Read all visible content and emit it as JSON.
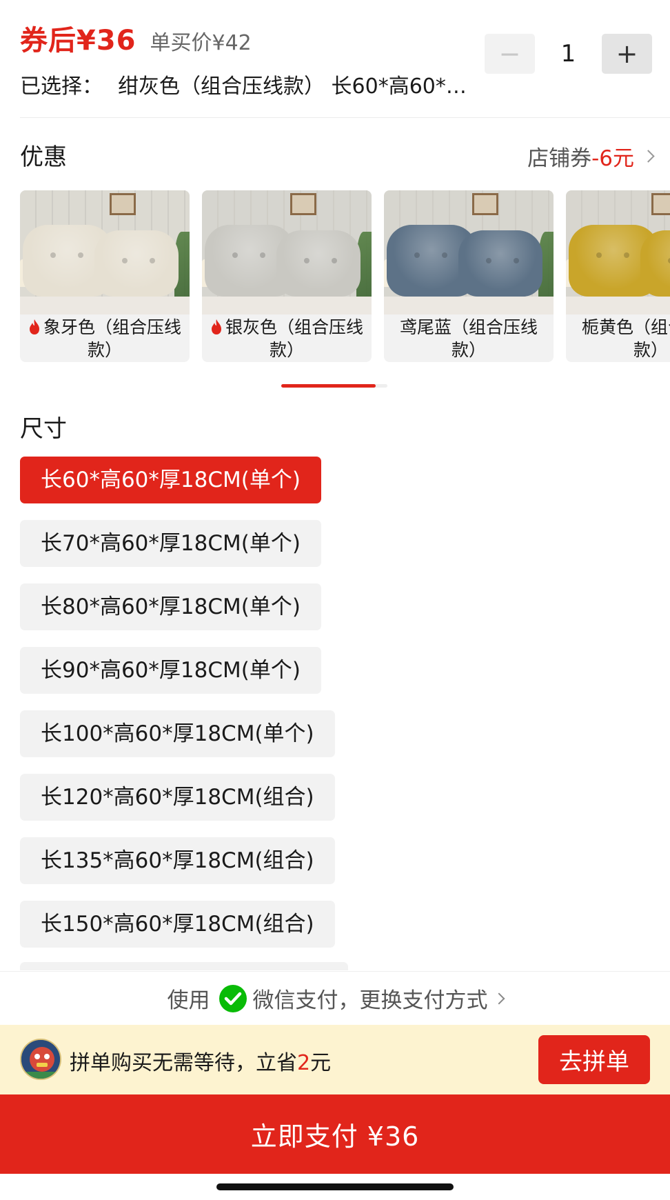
{
  "header": {
    "price_after_coupon": "券后¥36",
    "single_price": "单买价¥42",
    "quantity": "1",
    "minus_label": "−",
    "plus_label": "+",
    "selected_label": "已选择：",
    "selected_value": "绀灰色（组合压线款） 长60*高60*…"
  },
  "promo": {
    "title": "优惠",
    "coupon_label": "店铺券",
    "coupon_value": "-6元"
  },
  "colors": {
    "items": [
      {
        "label": "象牙色（组合压线款）",
        "hot": true,
        "pillow_color": "#e6e0d2",
        "wall_color": "#dcdad2"
      },
      {
        "label": "银灰色（组合压线款）",
        "hot": true,
        "pillow_color": "#c9c8c2",
        "wall_color": "#d6d5cf"
      },
      {
        "label": "鸢尾蓝（组合压线款）",
        "hot": false,
        "pillow_color": "#5d7287",
        "wall_color": "#d7d6cf"
      },
      {
        "label": "栀黄色（组合压线款）",
        "hot": false,
        "pillow_color": "#c9a52a",
        "wall_color": "#d8d6cf"
      }
    ],
    "scroll_progress": 0.89
  },
  "sizes": {
    "title": "尺寸",
    "options": [
      "长60*高60*厚18CM(单个)",
      "长70*高60*厚18CM(单个)",
      "长80*高60*厚18CM(单个)",
      "长90*高60*厚18CM(单个)",
      "长100*高60*厚18CM(单个)",
      "长120*高60*厚18CM(组合)",
      "长135*高60*厚18CM(组合)",
      "长150*高60*厚18CM(组合)"
    ],
    "selected_index": 0
  },
  "payment": {
    "prefix": "使用",
    "method": "微信支付，更换支付方式"
  },
  "group": {
    "text_before": "拼单购买无需等待，立省",
    "save_amount": "2",
    "text_after": "元",
    "button": "去拼单"
  },
  "pay_now": {
    "label": "立即支付 ¥36"
  },
  "theme": {
    "accent": "#e1251b",
    "group_bg": "#fdf3d0",
    "wechat_green": "#09bb07"
  }
}
